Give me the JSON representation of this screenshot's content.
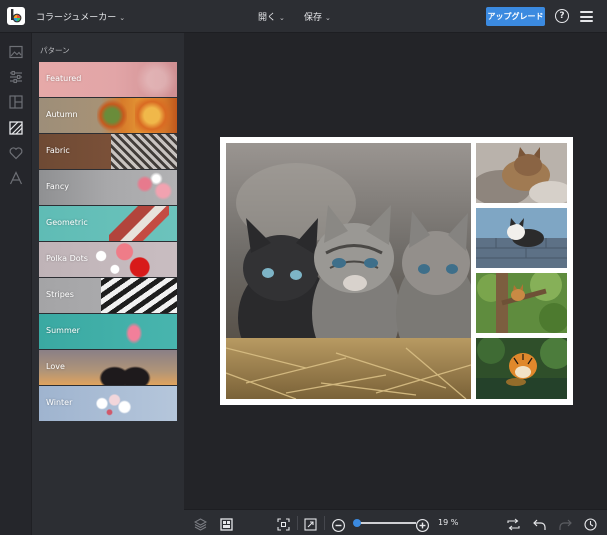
{
  "header": {
    "app_title": "コラージュメーカー",
    "open_label": "開く",
    "save_label": "保存",
    "upgrade_label": "アップグレード",
    "help_glyph": "?"
  },
  "rail": {
    "icons": [
      "photo-icon",
      "adjust-icon",
      "layout-icon",
      "pattern-icon",
      "heart-icon",
      "text-icon"
    ],
    "active": "pattern-icon"
  },
  "panel": {
    "title": "パターン",
    "patterns": [
      {
        "label": "Featured"
      },
      {
        "label": "Autumn"
      },
      {
        "label": "Fabric"
      },
      {
        "label": "Fancy"
      },
      {
        "label": "Geometric"
      },
      {
        "label": "Polka Dots"
      },
      {
        "label": "Stripes"
      },
      {
        "label": "Summer"
      },
      {
        "label": "Love"
      },
      {
        "label": "Winter"
      }
    ]
  },
  "toolbar": {
    "zoom_value": 19,
    "zoom_text": "19 %",
    "zoom_min_glyph": "−",
    "zoom_plus_glyph": "+"
  },
  "colors": {
    "accent": "#3b8ae0",
    "panel_bg": "#2c2e33",
    "canvas_bg": "#232428",
    "collage_border": "#ffffff"
  }
}
